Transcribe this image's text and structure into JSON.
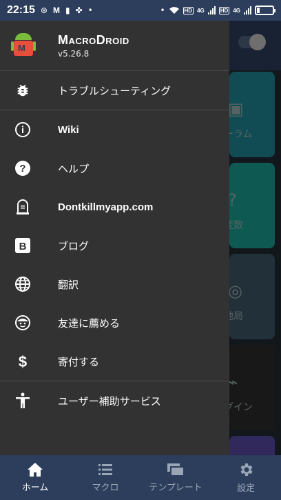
{
  "status_bar": {
    "time": "22:15",
    "hd_badge": "HD",
    "network": "4G",
    "battery_level": 0.15
  },
  "app": {
    "name": "MacroDroid",
    "version": "v5.26.8"
  },
  "background_tiles": [
    {
      "label": "ーラム",
      "color": "#1f8a9a"
    },
    {
      "label": "変数",
      "color": "#1aa596"
    },
    {
      "label": "地局",
      "color": "#3e5868"
    },
    {
      "label": "グイン",
      "color": "#2c2c2c"
    }
  ],
  "drawer": {
    "items": [
      {
        "label": "トラブルシューティング",
        "icon": "bug-icon"
      },
      {
        "label": "Wiki",
        "icon": "info-icon"
      },
      {
        "label": "ヘルプ",
        "icon": "help-icon"
      },
      {
        "label": "Dontkillmyapp.com",
        "icon": "tombstone-icon"
      },
      {
        "label": "ブログ",
        "icon": "blogger-icon"
      },
      {
        "label": "翻訳",
        "icon": "globe-icon"
      },
      {
        "label": "友達に薦める",
        "icon": "smiley-icon"
      },
      {
        "label": "寄付する",
        "icon": "dollar-icon"
      },
      {
        "label": "ユーザー補助サービス",
        "icon": "accessibility-icon"
      }
    ]
  },
  "bottom_nav": {
    "items": [
      {
        "label": "ホーム",
        "icon": "home-icon",
        "active": true
      },
      {
        "label": "マクロ",
        "icon": "list-icon",
        "active": false
      },
      {
        "label": "テンプレート",
        "icon": "templates-icon",
        "active": false
      },
      {
        "label": "設定",
        "icon": "gear-icon",
        "active": false
      }
    ]
  }
}
